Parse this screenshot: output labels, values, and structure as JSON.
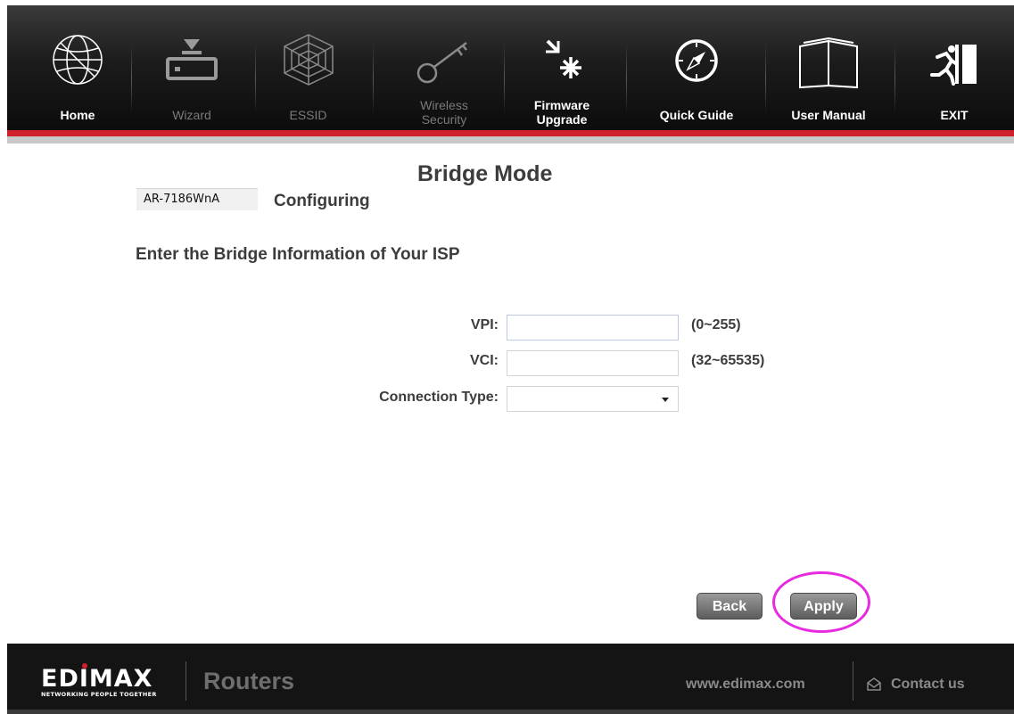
{
  "nav": {
    "home": "Home",
    "wizard": "Wizard",
    "essid": "ESSID",
    "wireless_security": [
      "Wireless",
      "Security"
    ],
    "firmware_upgrade": [
      "Firmware",
      "Upgrade"
    ],
    "quick_guide": "Quick Guide",
    "user_manual": "User Manual",
    "exit": "EXIT",
    "disabled_items": [
      "Wizard",
      "ESSID",
      "Wireless Security"
    ]
  },
  "page": {
    "title": "Bridge Mode",
    "model": "AR-7186WnA",
    "configuring": "Configuring",
    "section_heading": "Enter the Bridge Information of Your ISP"
  },
  "form": {
    "vpi": {
      "label": "VPI:",
      "value": "",
      "hint": "(0~255)"
    },
    "vci": {
      "label": "VCI:",
      "value": "",
      "hint": "(32~65535)"
    },
    "connection_type": {
      "label": "Connection Type:",
      "selected": ""
    }
  },
  "buttons": {
    "back": "Back",
    "apply": "Apply"
  },
  "footer": {
    "brand": "EDIMAX",
    "tagline": "NETWORKING PEOPLE TOGETHER",
    "product": "Routers",
    "website": "www.edimax.com",
    "contact": "Contact us"
  },
  "colors": {
    "accent_red": "#d0202c",
    "highlight_ring": "#e82ae0",
    "nav_background": "#1c1c1c"
  }
}
